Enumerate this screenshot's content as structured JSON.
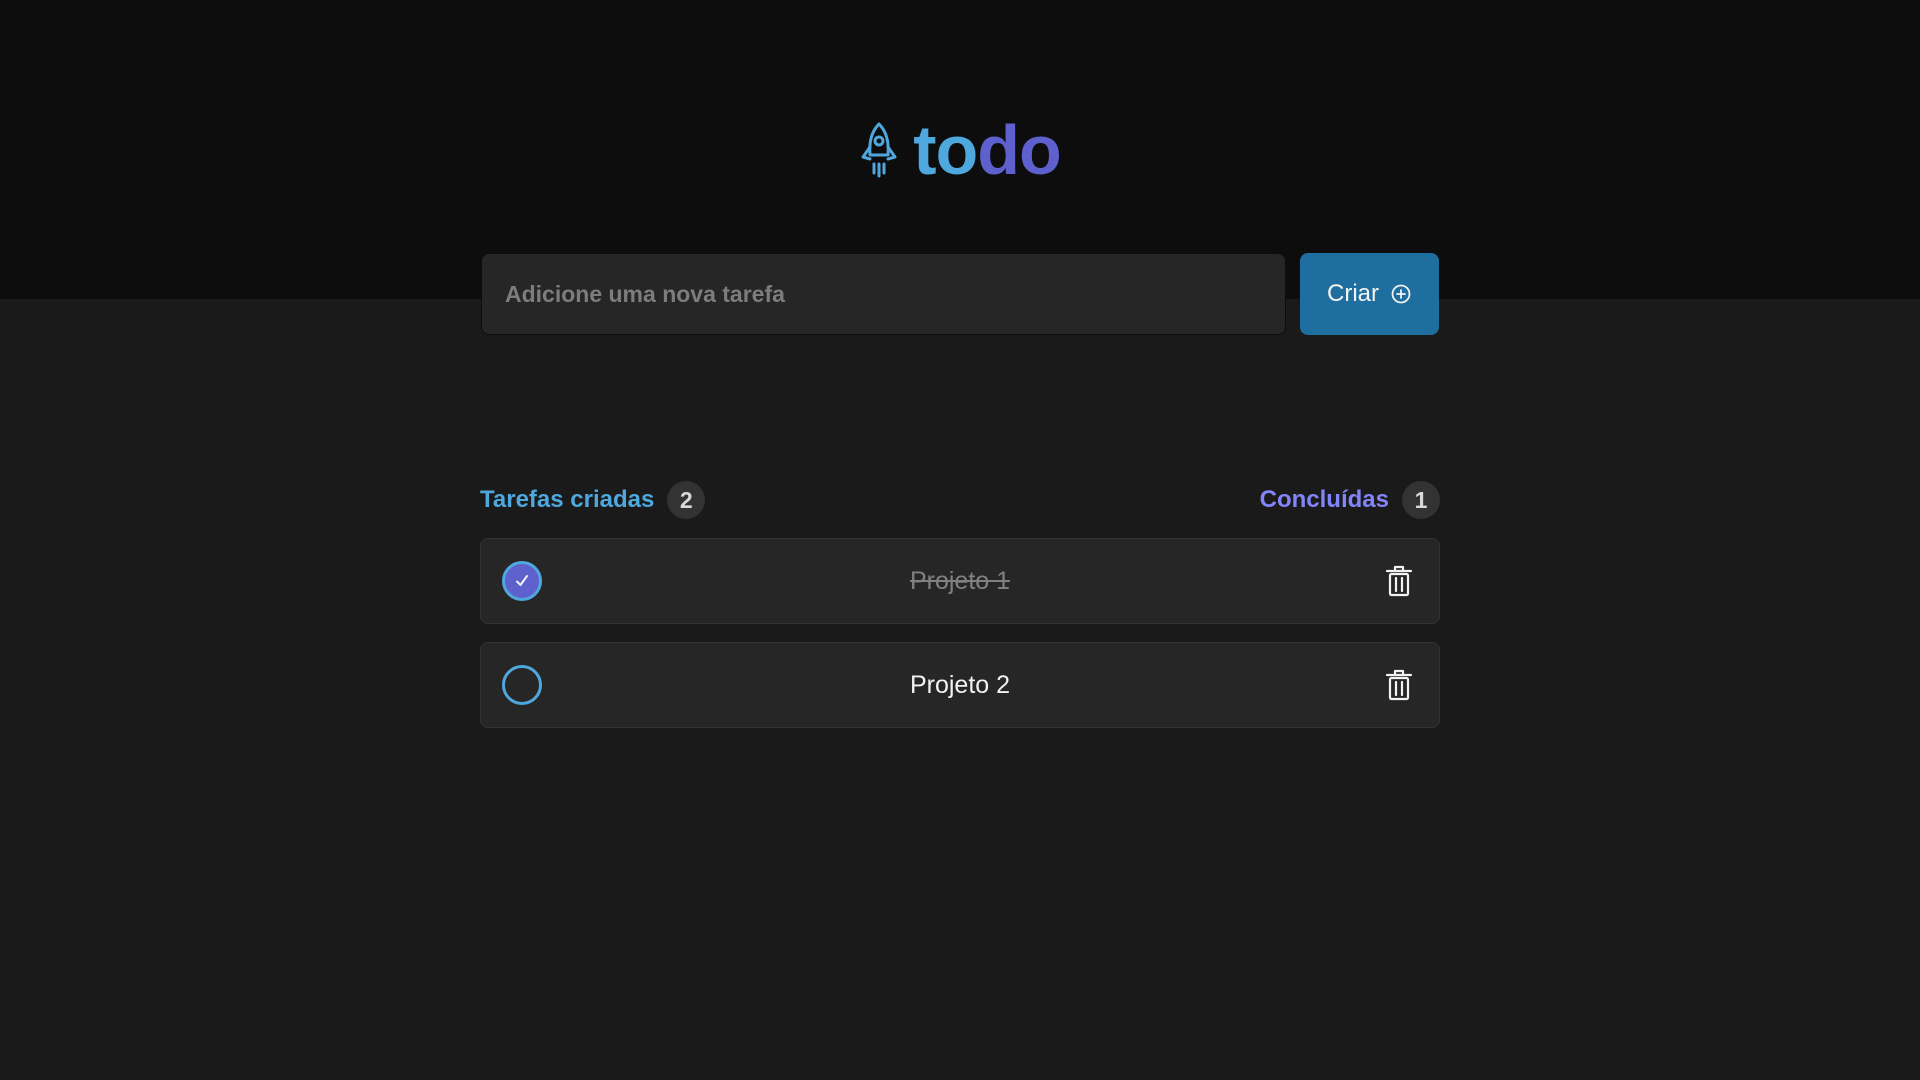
{
  "app": {
    "logo_text_to": "to",
    "logo_text_do": "do",
    "logo_icon": "rocket-icon"
  },
  "form": {
    "placeholder": "Adicione uma nova tarefa",
    "value": "",
    "create_label": "Criar",
    "create_icon": "plus-circle-icon"
  },
  "stats": {
    "created_label": "Tarefas criadas",
    "created_count": "2",
    "done_label": "Concluídas",
    "done_count": "1"
  },
  "tasks": [
    {
      "text": "Projeto 1",
      "done": true
    },
    {
      "text": "Projeto 2",
      "done": false
    }
  ],
  "colors": {
    "header_bg": "#0d0d0d",
    "body_bg": "#1a1a1a",
    "blue": "#4ea8de",
    "blue_dark": "#1e6f9f",
    "purple": "#5e60ce",
    "purple_light": "#8284fa"
  }
}
